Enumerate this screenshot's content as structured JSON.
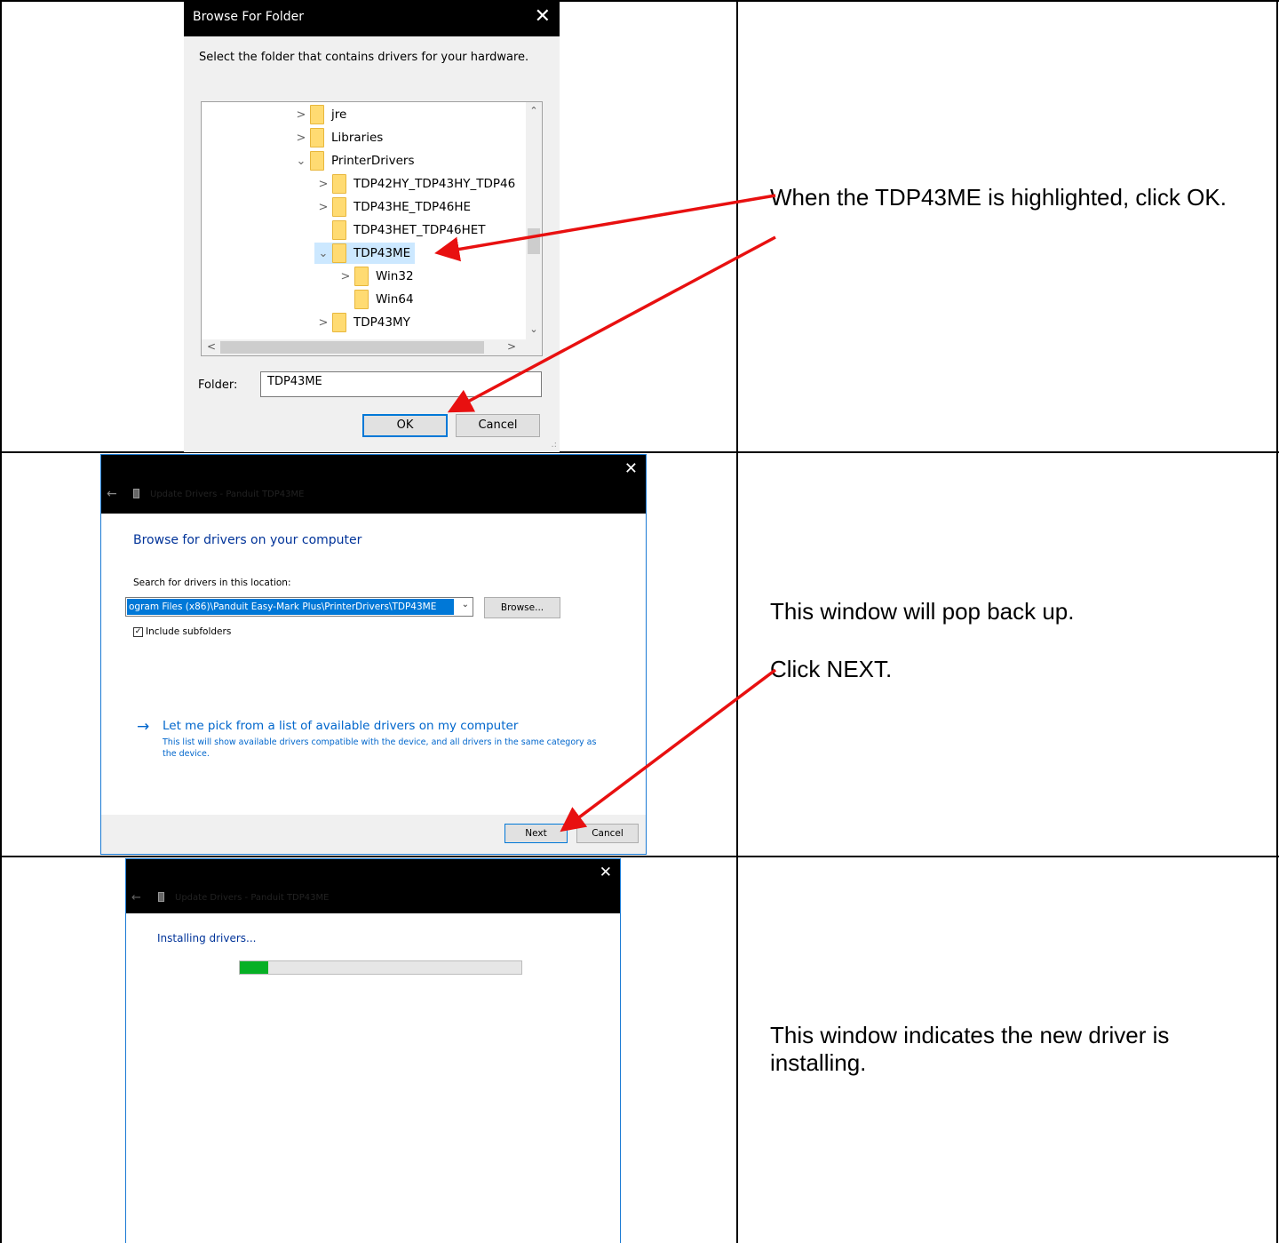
{
  "rows": [
    {
      "instruction": "When the TDP43ME is highlighted, click OK."
    },
    {
      "instruction_1": "This window will pop back up.",
      "instruction_2": "Click NEXT."
    },
    {
      "instruction": "This window indicates the new driver is installing."
    }
  ],
  "browse_folder_dialog": {
    "title": "Browse For Folder",
    "close": "✕",
    "instruction": "Select the folder that contains drivers for your hardware.",
    "tree": [
      {
        "label": "jre",
        "chevron": ">",
        "selected": false
      },
      {
        "label": "Libraries",
        "chevron": ">",
        "selected": false
      },
      {
        "label": "PrinterDrivers",
        "chevron": "v",
        "selected": false
      },
      {
        "label": "TDP42HY_TDP43HY_TDP46",
        "chevron": ">",
        "selected": false
      },
      {
        "label": "TDP43HE_TDP46HE",
        "chevron": ">",
        "selected": false
      },
      {
        "label": "TDP43HET_TDP46HET",
        "chevron": "",
        "selected": false
      },
      {
        "label": "TDP43ME",
        "chevron": "v",
        "selected": true
      },
      {
        "label": "Win32",
        "chevron": ">",
        "selected": false
      },
      {
        "label": "Win64",
        "chevron": "",
        "selected": false
      },
      {
        "label": "TDP43MY",
        "chevron": ">",
        "selected": false
      }
    ],
    "folder_label": "Folder:",
    "folder_value": "TDP43ME",
    "ok_label": "OK",
    "cancel_label": "Cancel"
  },
  "update_drivers_window": {
    "title": "Update Drivers - Panduit TDP43ME",
    "heading": "Browse for drivers on your computer",
    "search_label": "Search for drivers in this location:",
    "path": "ogram Files (x86)\\Panduit Easy-Mark Plus\\PrinterDrivers\\TDP43ME",
    "browse_label": "Browse...",
    "include_subfolders_label": "Include subfolders",
    "include_subfolders_checked": true,
    "pick_link": "Let me pick from a list of available drivers on my computer",
    "pick_desc": "This list will show available drivers compatible with the device, and all drivers in the same category as the device.",
    "next_label": "Next",
    "cancel_label": "Cancel"
  },
  "installing_window": {
    "title": "Update Drivers - Panduit TDP43ME",
    "heading": "Installing drivers...",
    "progress": 0.1,
    "progress_color": "#06b025"
  },
  "colors": {
    "arrow": "#e81010",
    "selection": "#cce8ff",
    "link": "#0066cc"
  }
}
